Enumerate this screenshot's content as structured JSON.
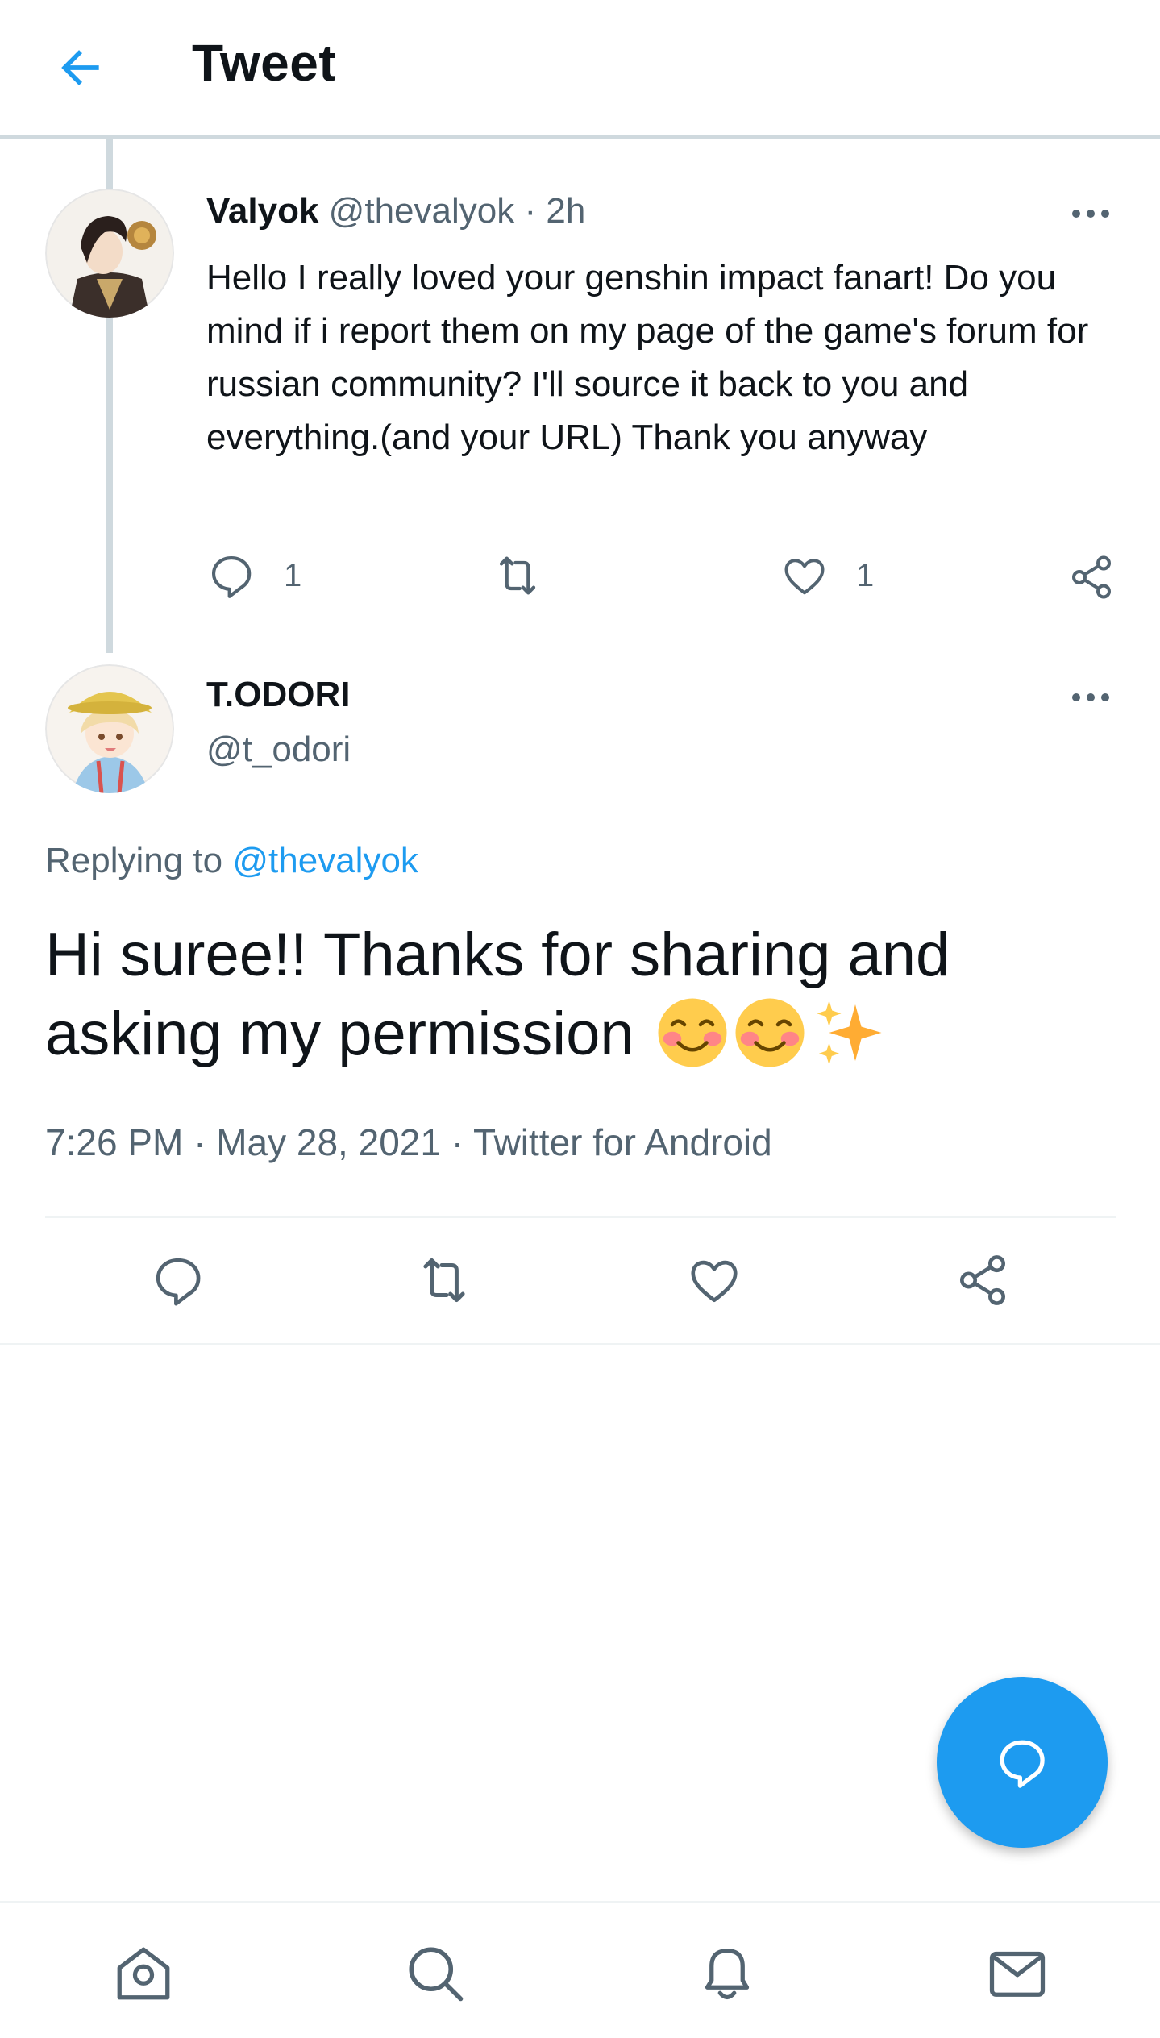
{
  "header": {
    "title": "Tweet",
    "back_icon": "arrow-left-icon"
  },
  "colors": {
    "accent": "#1d9bf0",
    "text": "#0f1419",
    "muted": "#536471",
    "divider": "#eff3f4"
  },
  "parent_tweet": {
    "name": "Valyok",
    "handle": "@thevalyok",
    "dot_time": "· 2h",
    "text": "Hello I really loved your genshin impact fanart! Do you mind if i report them on my page of the game's forum for russian community? I'll source it back to you and everything.(and your URL) Thank you anyway",
    "reply_count": "1",
    "like_count": "1"
  },
  "main_tweet": {
    "name": "T.ODORI",
    "handle": "@t_odori",
    "replying_prefix": "Replying to ",
    "replying_handle": "@thevalyok",
    "text": "Hi suree!! Thanks for sharing and asking my permission",
    "emojis": [
      "smiling-face-icon",
      "smiling-face-icon",
      "sparkles-icon"
    ],
    "time": "7:26 PM",
    "date": "May 28, 2021",
    "source": "Twitter for Android"
  },
  "bottom_nav": [
    "home-icon",
    "search-icon",
    "bell-icon",
    "mail-icon"
  ]
}
